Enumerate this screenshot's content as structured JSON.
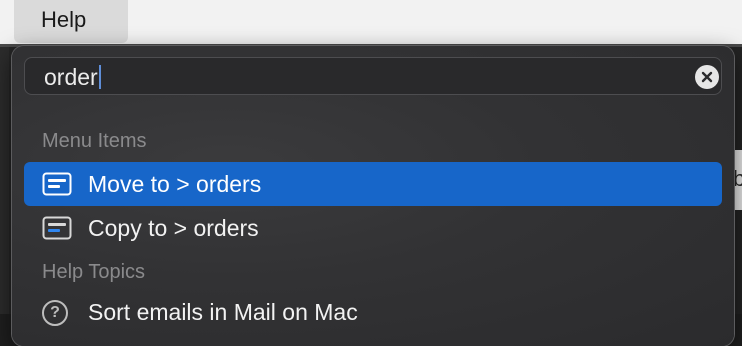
{
  "menubar": {
    "help_label": "Help"
  },
  "search": {
    "value": "order"
  },
  "sections": {
    "menu_items_header": "Menu Items",
    "help_topics_header": "Help Topics"
  },
  "menu_items": [
    {
      "label": "Move to > orders",
      "icon": "menu-item-icon",
      "selected": true
    },
    {
      "label": "Copy to > orders",
      "icon": "menu-item-icon",
      "selected": false
    }
  ],
  "help_topics": [
    {
      "label": "Sort emails in Mail on Mac",
      "icon": "help-topic-icon"
    }
  ],
  "background": {
    "partial_letter": "b"
  },
  "colors": {
    "selection": "#1766c9",
    "popup_background": "#323234",
    "menubar_background": "#f2f2f2"
  }
}
